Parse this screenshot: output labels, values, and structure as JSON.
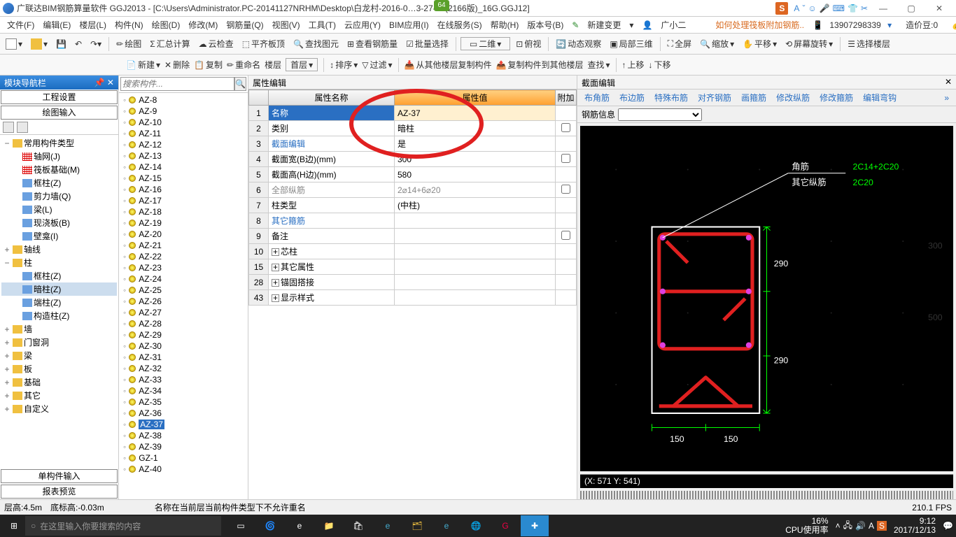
{
  "titlebar": {
    "title": "广联达BIM钢筋算量软件 GGJ2013 - [C:\\Users\\Administrator.PC-20141127NRHM\\Desktop\\白龙村-2016-0…3-27-07(2166版)_16G.GGJ12]",
    "badge": "64"
  },
  "menus": [
    "文件(F)",
    "编辑(E)",
    "楼层(L)",
    "构件(N)",
    "绘图(D)",
    "修改(M)",
    "钢筋量(Q)",
    "视图(V)",
    "工具(T)",
    "云应用(Y)",
    "BIM应用(I)",
    "在线服务(S)",
    "帮助(H)",
    "版本号(B)"
  ],
  "menu_right": {
    "new_change": "新建变更",
    "user": "广小二",
    "help_link": "如何处理筏板附加钢筋..",
    "phone": "13907298339",
    "coin_label": "造价豆:0"
  },
  "toolbar1": {
    "draw": "绘图",
    "sum": "汇总计算",
    "cloud": "云检查",
    "flat": "平齐板顶",
    "findimg": "查找图元",
    "viewrebar": "查看钢筋量",
    "batch": "批量选择",
    "two_d": "二维",
    "overlook": "俯视",
    "dyn": "动态观察",
    "local3d": "局部三维",
    "fullscreen": "全屏",
    "zoom": "缩放",
    "pan": "平移",
    "rotate": "屏幕旋转",
    "select_floor": "选择楼层"
  },
  "nav": {
    "header": "模块导航栏",
    "tabs": [
      "工程设置",
      "绘图输入"
    ],
    "bottom_tabs": [
      "单构件输入",
      "报表预览"
    ]
  },
  "tree": {
    "root": [
      {
        "label": "常用构件类型",
        "exp": "−",
        "children": [
          {
            "label": "轴网(J)",
            "ico": "grid"
          },
          {
            "label": "筏板基础(M)",
            "ico": "grid"
          },
          {
            "label": "框柱(Z)",
            "ico": "col"
          },
          {
            "label": "剪力墙(Q)",
            "ico": "col"
          },
          {
            "label": "梁(L)",
            "ico": "col"
          },
          {
            "label": "现浇板(B)",
            "ico": "col"
          },
          {
            "label": "壁龛(I)",
            "ico": "col"
          }
        ]
      },
      {
        "label": "轴线",
        "exp": "+"
      },
      {
        "label": "柱",
        "exp": "−",
        "children": [
          {
            "label": "框柱(Z)",
            "ico": "col"
          },
          {
            "label": "暗柱(Z)",
            "ico": "col",
            "sel": true
          },
          {
            "label": "端柱(Z)",
            "ico": "col"
          },
          {
            "label": "构造柱(Z)",
            "ico": "col"
          }
        ]
      },
      {
        "label": "墙",
        "exp": "+"
      },
      {
        "label": "门窗洞",
        "exp": "+"
      },
      {
        "label": "梁",
        "exp": "+"
      },
      {
        "label": "板",
        "exp": "+"
      },
      {
        "label": "基础",
        "exp": "+"
      },
      {
        "label": "其它",
        "exp": "+"
      },
      {
        "label": "自定义",
        "exp": "+"
      }
    ]
  },
  "list_toolbar": {
    "new": "新建",
    "del": "删除",
    "copy": "复制",
    "rename": "重命名",
    "floor": "楼层",
    "first": "首层",
    "sort": "排序",
    "filter": "过滤",
    "copyfrom": "从其他楼层复制构件",
    "copyto": "复制构件到其他楼层",
    "search2": "查找",
    "up": "上移",
    "down": "下移"
  },
  "search_placeholder": "搜索构件...",
  "components": [
    "AZ-8",
    "AZ-9",
    "AZ-10",
    "AZ-11",
    "AZ-12",
    "AZ-13",
    "AZ-14",
    "AZ-15",
    "AZ-16",
    "AZ-17",
    "AZ-18",
    "AZ-19",
    "AZ-20",
    "AZ-21",
    "AZ-22",
    "AZ-23",
    "AZ-24",
    "AZ-25",
    "AZ-26",
    "AZ-27",
    "AZ-28",
    "AZ-29",
    "AZ-30",
    "AZ-31",
    "AZ-32",
    "AZ-33",
    "AZ-34",
    "AZ-35",
    "AZ-36",
    "AZ-37",
    "AZ-38",
    "AZ-39",
    "GZ-1",
    "AZ-40"
  ],
  "selected_component": "AZ-37",
  "props": {
    "title": "属性编辑",
    "headers": {
      "name": "属性名称",
      "value": "属性值",
      "extra": "附加"
    },
    "rows": [
      {
        "n": "1",
        "name": "名称",
        "value": "AZ-37",
        "sel": true
      },
      {
        "n": "2",
        "name": "类别",
        "value": "暗柱",
        "chk": false,
        "black": true
      },
      {
        "n": "3",
        "name": "截面编辑",
        "value": "是",
        "blue": true
      },
      {
        "n": "4",
        "name": "截面宽(B边)(mm)",
        "value": "300",
        "chk": false,
        "black": true
      },
      {
        "n": "5",
        "name": "截面高(H边)(mm)",
        "value": "580",
        "black": true
      },
      {
        "n": "6",
        "name": "全部纵筋",
        "value": "2⌀14+6⌀20",
        "chk": false,
        "gray": true
      },
      {
        "n": "7",
        "name": "柱类型",
        "value": "(中柱)",
        "black": true
      },
      {
        "n": "8",
        "name": "其它箍筋",
        "value": "",
        "blue": true
      },
      {
        "n": "9",
        "name": "备注",
        "value": "",
        "chk": false,
        "black": true
      },
      {
        "n": "10",
        "name": "芯柱",
        "exp": true,
        "black": true
      },
      {
        "n": "15",
        "name": "其它属性",
        "exp": true,
        "black": true
      },
      {
        "n": "28",
        "name": "锚固搭接",
        "exp": true,
        "black": true
      },
      {
        "n": "43",
        "name": "显示样式",
        "exp": true,
        "black": true
      }
    ]
  },
  "canvas": {
    "title": "截面编辑",
    "buttons": [
      "布角筋",
      "布边筋",
      "特殊布筋",
      "对齐钢筋",
      "画箍筋",
      "修改纵筋",
      "修改箍筋",
      "编辑弯钩"
    ],
    "rebar_label": "钢筋信息",
    "labels": {
      "corner": "角筋",
      "other_v": "其它纵筋",
      "corner_val": "2C14+2C20",
      "other_val": "2C20"
    },
    "dims": {
      "h1": "290",
      "h2": "290",
      "w1": "150",
      "w2": "150",
      "dim500": "500"
    },
    "coords": "(X: 571 Y: 541)"
  },
  "status": {
    "floor_h": "层高:4.5m",
    "bottom_h": "底标高:-0.03m",
    "msg": "名称在当前层当前构件类型下不允许重名",
    "fps": "210.1 FPS"
  },
  "taskbar": {
    "search": "在这里输入你要搜索的内容",
    "cpu": "16%",
    "cpu_label": "CPU使用率",
    "time": "9:12",
    "date": "2017/12/13"
  }
}
